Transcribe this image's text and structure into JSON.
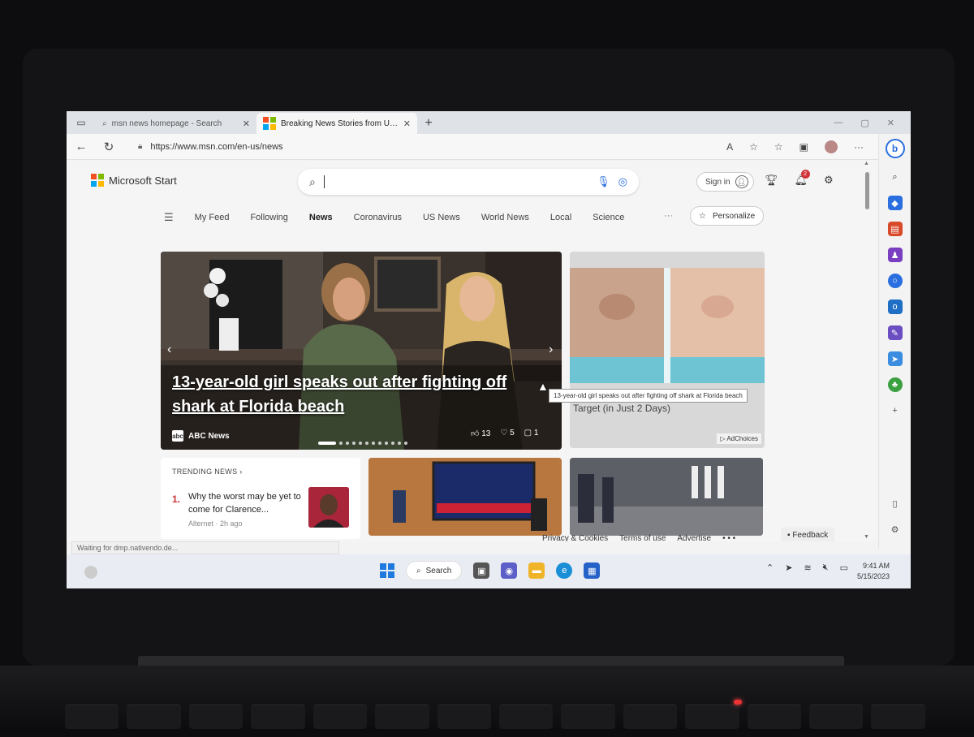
{
  "browser": {
    "tabs": [
      {
        "title": "msn news homepage - Search",
        "active": false
      },
      {
        "title": "Breaking News Stories from US a",
        "active": true
      }
    ],
    "url": "https://www.msn.com/en-us/news",
    "status_text": "Waiting for dmp.nativendo.de..."
  },
  "header": {
    "brand": "Microsoft Start",
    "search_placeholder": "",
    "signin_label": "Sign in",
    "notification_count": "2"
  },
  "nav": {
    "items": [
      "My Feed",
      "Following",
      "News",
      "Coronavirus",
      "US News",
      "World News",
      "Local",
      "Science"
    ],
    "active": "News",
    "more": "···",
    "personalize": "Personalize"
  },
  "hero": {
    "headline": "13-year-old girl speaks out after fighting off shark at Florida beach",
    "source": "ABC News",
    "likes": "13",
    "reactions": "5",
    "comments": "1",
    "tooltip": "13-year-old girl speaks out after fighting off shark at Florida beach"
  },
  "ad": {
    "caption": "Target (in Just 2 Days)",
    "choices": "AdChoices"
  },
  "trending": {
    "title": "TRENDING NEWS",
    "rank": "1.",
    "story": "Why the worst may be yet to come for Clarence...",
    "meta": "Alternet · 2h ago"
  },
  "footer": {
    "links": [
      "Privacy & Cookies",
      "Terms of use",
      "Advertise",
      "• • •"
    ],
    "feedback": "Feedback"
  },
  "taskbar": {
    "search_label": "Search",
    "time": "9:41 AM",
    "date": "5/15/2023"
  },
  "colors": {
    "accent": "#2a6ee0",
    "headline": "#ffffff",
    "badge": "#d13438"
  }
}
